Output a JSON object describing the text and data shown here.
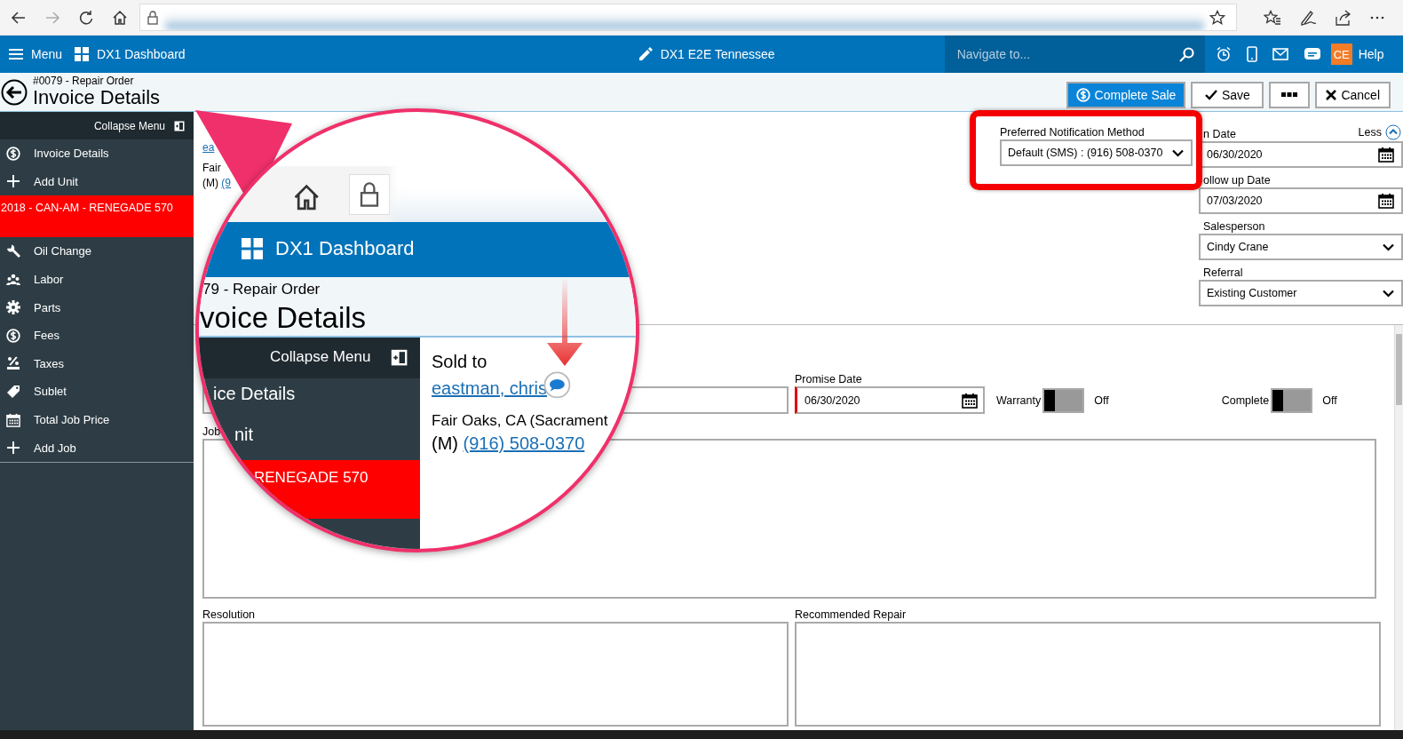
{
  "app_bar": {
    "menu_label": "Menu",
    "dashboard_label": "DX1 Dashboard",
    "location": "DX1 E2E Tennessee",
    "search": {
      "placeholder": "Navigate to..."
    },
    "user_initials": "CE",
    "help": "Help"
  },
  "header": {
    "subtitle": "#0079 - Repair Order",
    "title": "Invoice Details",
    "buttons": [
      {
        "label": "Complete Sale",
        "kind": "primary"
      },
      {
        "label": "Save",
        "kind": "save"
      },
      {
        "kind": "more"
      },
      {
        "label": "Cancel",
        "kind": "cancel"
      }
    ]
  },
  "sidebar": {
    "collapse_label": "Collapse Menu",
    "items": [
      {
        "label": "Invoice Details",
        "kind": "nav"
      },
      {
        "label": "Add Unit",
        "kind": "nav"
      },
      {
        "label": "2018 - CAN-AM - RENEGADE 570",
        "kind": "unit"
      },
      {
        "label": "Oil Change",
        "kind": "nav"
      },
      {
        "label": "Labor",
        "kind": "nav"
      },
      {
        "label": "Parts",
        "kind": "nav"
      },
      {
        "label": "Fees",
        "kind": "nav"
      },
      {
        "label": "Taxes",
        "kind": "nav"
      },
      {
        "label": "Sublet",
        "kind": "nav"
      },
      {
        "label": "Total Job Price",
        "kind": "nav"
      },
      {
        "label": "Add Job",
        "kind": "nav"
      }
    ]
  },
  "customer": {
    "link": "ea",
    "city": "Fair",
    "phone_prefix": "(M)",
    "phone_link": "(9"
  },
  "notification": {
    "label": "Preferred Notification Method",
    "value": "Default (SMS) : (916) 508-0370"
  },
  "details": {
    "less": "Less",
    "fields": [
      {
        "label": "n Date",
        "value": "06/30/2020",
        "kind": "date"
      },
      {
        "label": "ollow up Date",
        "value": "07/03/2020",
        "kind": "date"
      },
      {
        "label": "Salesperson",
        "value": "Cindy Crane",
        "kind": "select"
      },
      {
        "label": "Referral",
        "value": "Existing Customer",
        "kind": "select"
      }
    ]
  },
  "job": {
    "promise_date": {
      "label": "Promise Date",
      "value": "06/30/2020",
      "required": true
    },
    "toggles": [
      {
        "label": "Warranty",
        "on": false,
        "state_text": "Off"
      },
      {
        "label": "Complete",
        "on": false,
        "state_text": "Off"
      }
    ],
    "job_label": "Job",
    "text_areas": [
      {
        "label": "Resolution"
      },
      {
        "label": "Recommended Repair"
      }
    ]
  },
  "magnifier": {
    "dashboard_label": "DX1 Dashboard",
    "subtitle": "79 - Repair Order",
    "title": "voice Details",
    "collapse_label": "Collapse Menu",
    "items": [
      "ice Details",
      "nit"
    ],
    "unit": "RENEGADE 570",
    "sold_to": "Sold to",
    "customer_link": "eastman, chris",
    "city": "Fair Oaks, CA (Sacrament",
    "phone_prefix": "(M)",
    "phone_link": "(916) 508-0370"
  }
}
